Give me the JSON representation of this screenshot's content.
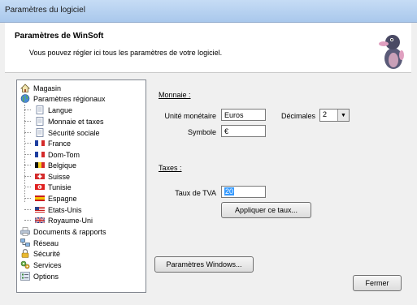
{
  "window": {
    "title": "Paramètres du logiciel"
  },
  "header": {
    "title": "Paramètres de WinSoft",
    "subtitle": "Vous pouvez régler ici tous les paramètres de votre logiciel."
  },
  "tree": {
    "items": [
      {
        "label": "Magasin",
        "icon": "house-icon"
      },
      {
        "label": "Paramètres régionaux",
        "icon": "globe-icon"
      },
      {
        "label": "Langue",
        "icon": "page-icon"
      },
      {
        "label": "Monnaie et taxes",
        "icon": "page-icon"
      },
      {
        "label": "Sécurité sociale",
        "icon": "page-icon"
      },
      {
        "label": "France",
        "icon": "flag-france-icon"
      },
      {
        "label": "Dom-Tom",
        "icon": "flag-france-icon"
      },
      {
        "label": "Belgique",
        "icon": "flag-belgium-icon"
      },
      {
        "label": "Suisse",
        "icon": "flag-switzerland-icon"
      },
      {
        "label": "Tunisie",
        "icon": "flag-tunisia-icon"
      },
      {
        "label": "Espagne",
        "icon": "flag-spain-icon"
      },
      {
        "label": "Etats-Unis",
        "icon": "flag-usa-icon"
      },
      {
        "label": "Royaume-Uni",
        "icon": "flag-uk-icon"
      },
      {
        "label": "Documents & rapports",
        "icon": "printer-icon"
      },
      {
        "label": "Réseau",
        "icon": "network-icon"
      },
      {
        "label": "Sécurité",
        "icon": "lock-icon"
      },
      {
        "label": "Services",
        "icon": "gears-icon"
      },
      {
        "label": "Options",
        "icon": "options-icon"
      }
    ]
  },
  "monnaie": {
    "group_label": "Monnaie :",
    "unite_label": "Unité monétaire",
    "unite_value": "Euros",
    "decimales_label": "Décimales",
    "decimales_value": "2",
    "symbole_label": "Symbole",
    "symbole_value": "€"
  },
  "taxes": {
    "group_label": "Taxes :",
    "tva_label": "Taux de TVA",
    "tva_value": "20",
    "apply_label": "Appliquer ce taux..."
  },
  "buttons": {
    "windows_params": "Paramètres Windows...",
    "close": "Fermer"
  },
  "colors": {
    "title_bar": "#b8d3f2",
    "selection": "#3399ff"
  }
}
